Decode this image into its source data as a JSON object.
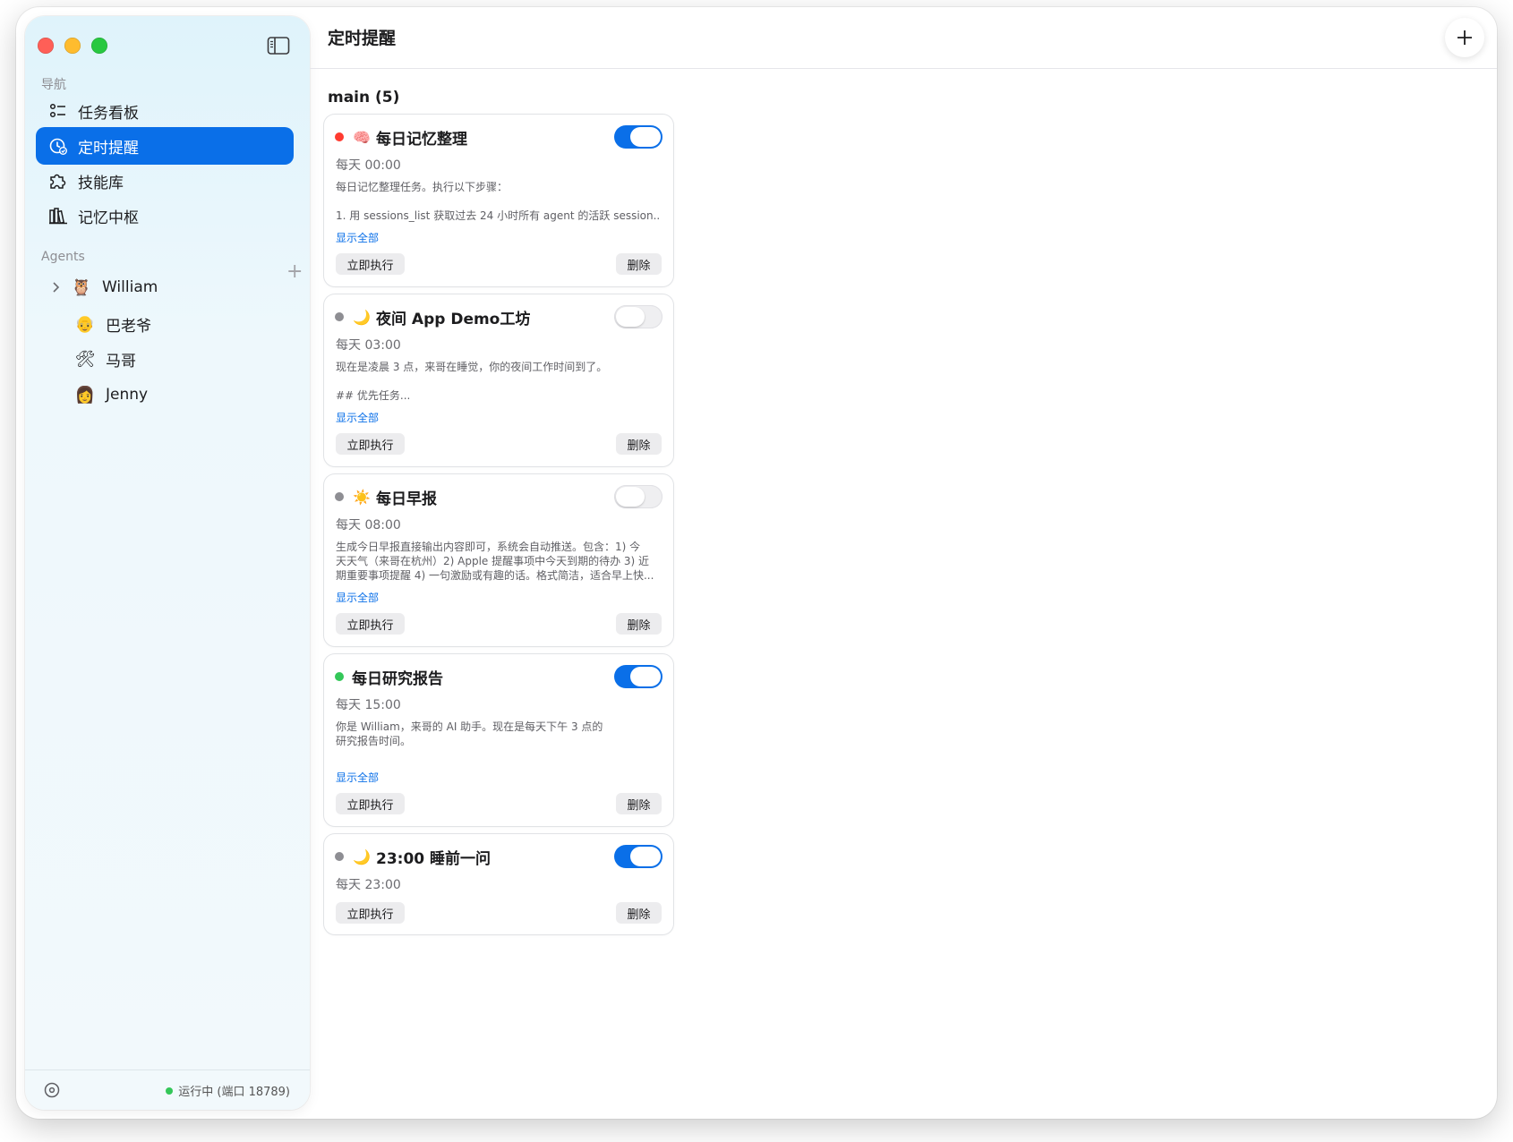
{
  "header": {
    "title": "定时提醒"
  },
  "sidebar": {
    "nav_label": "导航",
    "nav": [
      {
        "label": "任务看板",
        "icon": "task-board-icon"
      },
      {
        "label": "定时提醒",
        "icon": "clock-icon",
        "active": true
      },
      {
        "label": "技能库",
        "icon": "puzzle-icon"
      },
      {
        "label": "记忆中枢",
        "icon": "books-icon"
      }
    ],
    "agents_label": "Agents",
    "agents": [
      {
        "name": "William",
        "emoji": "🦉"
      },
      {
        "name": "巴老爷",
        "emoji": "👴"
      },
      {
        "name": "马哥",
        "emoji": "🛠"
      },
      {
        "name": "Jenny",
        "emoji": "👩"
      }
    ],
    "status": "运行中 (端口 18789)"
  },
  "main": {
    "group_title": "main (5)",
    "show_all": "显示全部",
    "run_now": "立即执行",
    "delete": "删除",
    "cards": [
      {
        "title": "每日记忆整理",
        "emoji": "🧠",
        "dot_color": "#ff3b30",
        "enabled": true,
        "schedule": "每天 00:00",
        "desc": [
          "每日记忆整理任务。执行以下步骤：",
          "",
          "1. 用 sessions_list 获取过去 24 小时所有 agent 的活跃 session..."
        ]
      },
      {
        "title": "夜间 App Demo工坊",
        "emoji": "🌙",
        "dot_color": "#8e8e93",
        "enabled": false,
        "schedule": "每天 03:00",
        "desc": [
          "现在是凌晨 3 点，来哥在睡觉，你的夜间工作时间到了。",
          "",
          "## 优先任务..."
        ]
      },
      {
        "title": "每日早报",
        "emoji": "☀️",
        "dot_color": "#8e8e93",
        "enabled": false,
        "schedule": "每天 08:00",
        "desc": [
          "生成今日早报直接输出内容即可，系统会自动推送。包含：1) 今",
          "天天气（来哥在杭州）2) Apple 提醒事项中今天到期的待办 3) 近",
          "期重要事项提醒 4) 一句激励或有趣的话。格式简洁，适合早上快..."
        ]
      },
      {
        "title": "每日研究报告",
        "emoji": "",
        "dot_color": "#34c759",
        "enabled": true,
        "schedule": "每天 15:00",
        "desc": [
          "你是 William，来哥的 AI 助手。现在是每天下午 3 点的",
          "研究报告时间。",
          ""
        ]
      },
      {
        "title": "23:00 睡前一问",
        "emoji": "🌙",
        "dot_color": "#8e8e93",
        "enabled": true,
        "schedule": "每天 23:00",
        "desc": []
      }
    ]
  },
  "colors": {
    "accent": "#0a6fe8",
    "status_green": "#34c759",
    "dot_red": "#ff3b30",
    "dot_gray": "#8e8e93"
  }
}
